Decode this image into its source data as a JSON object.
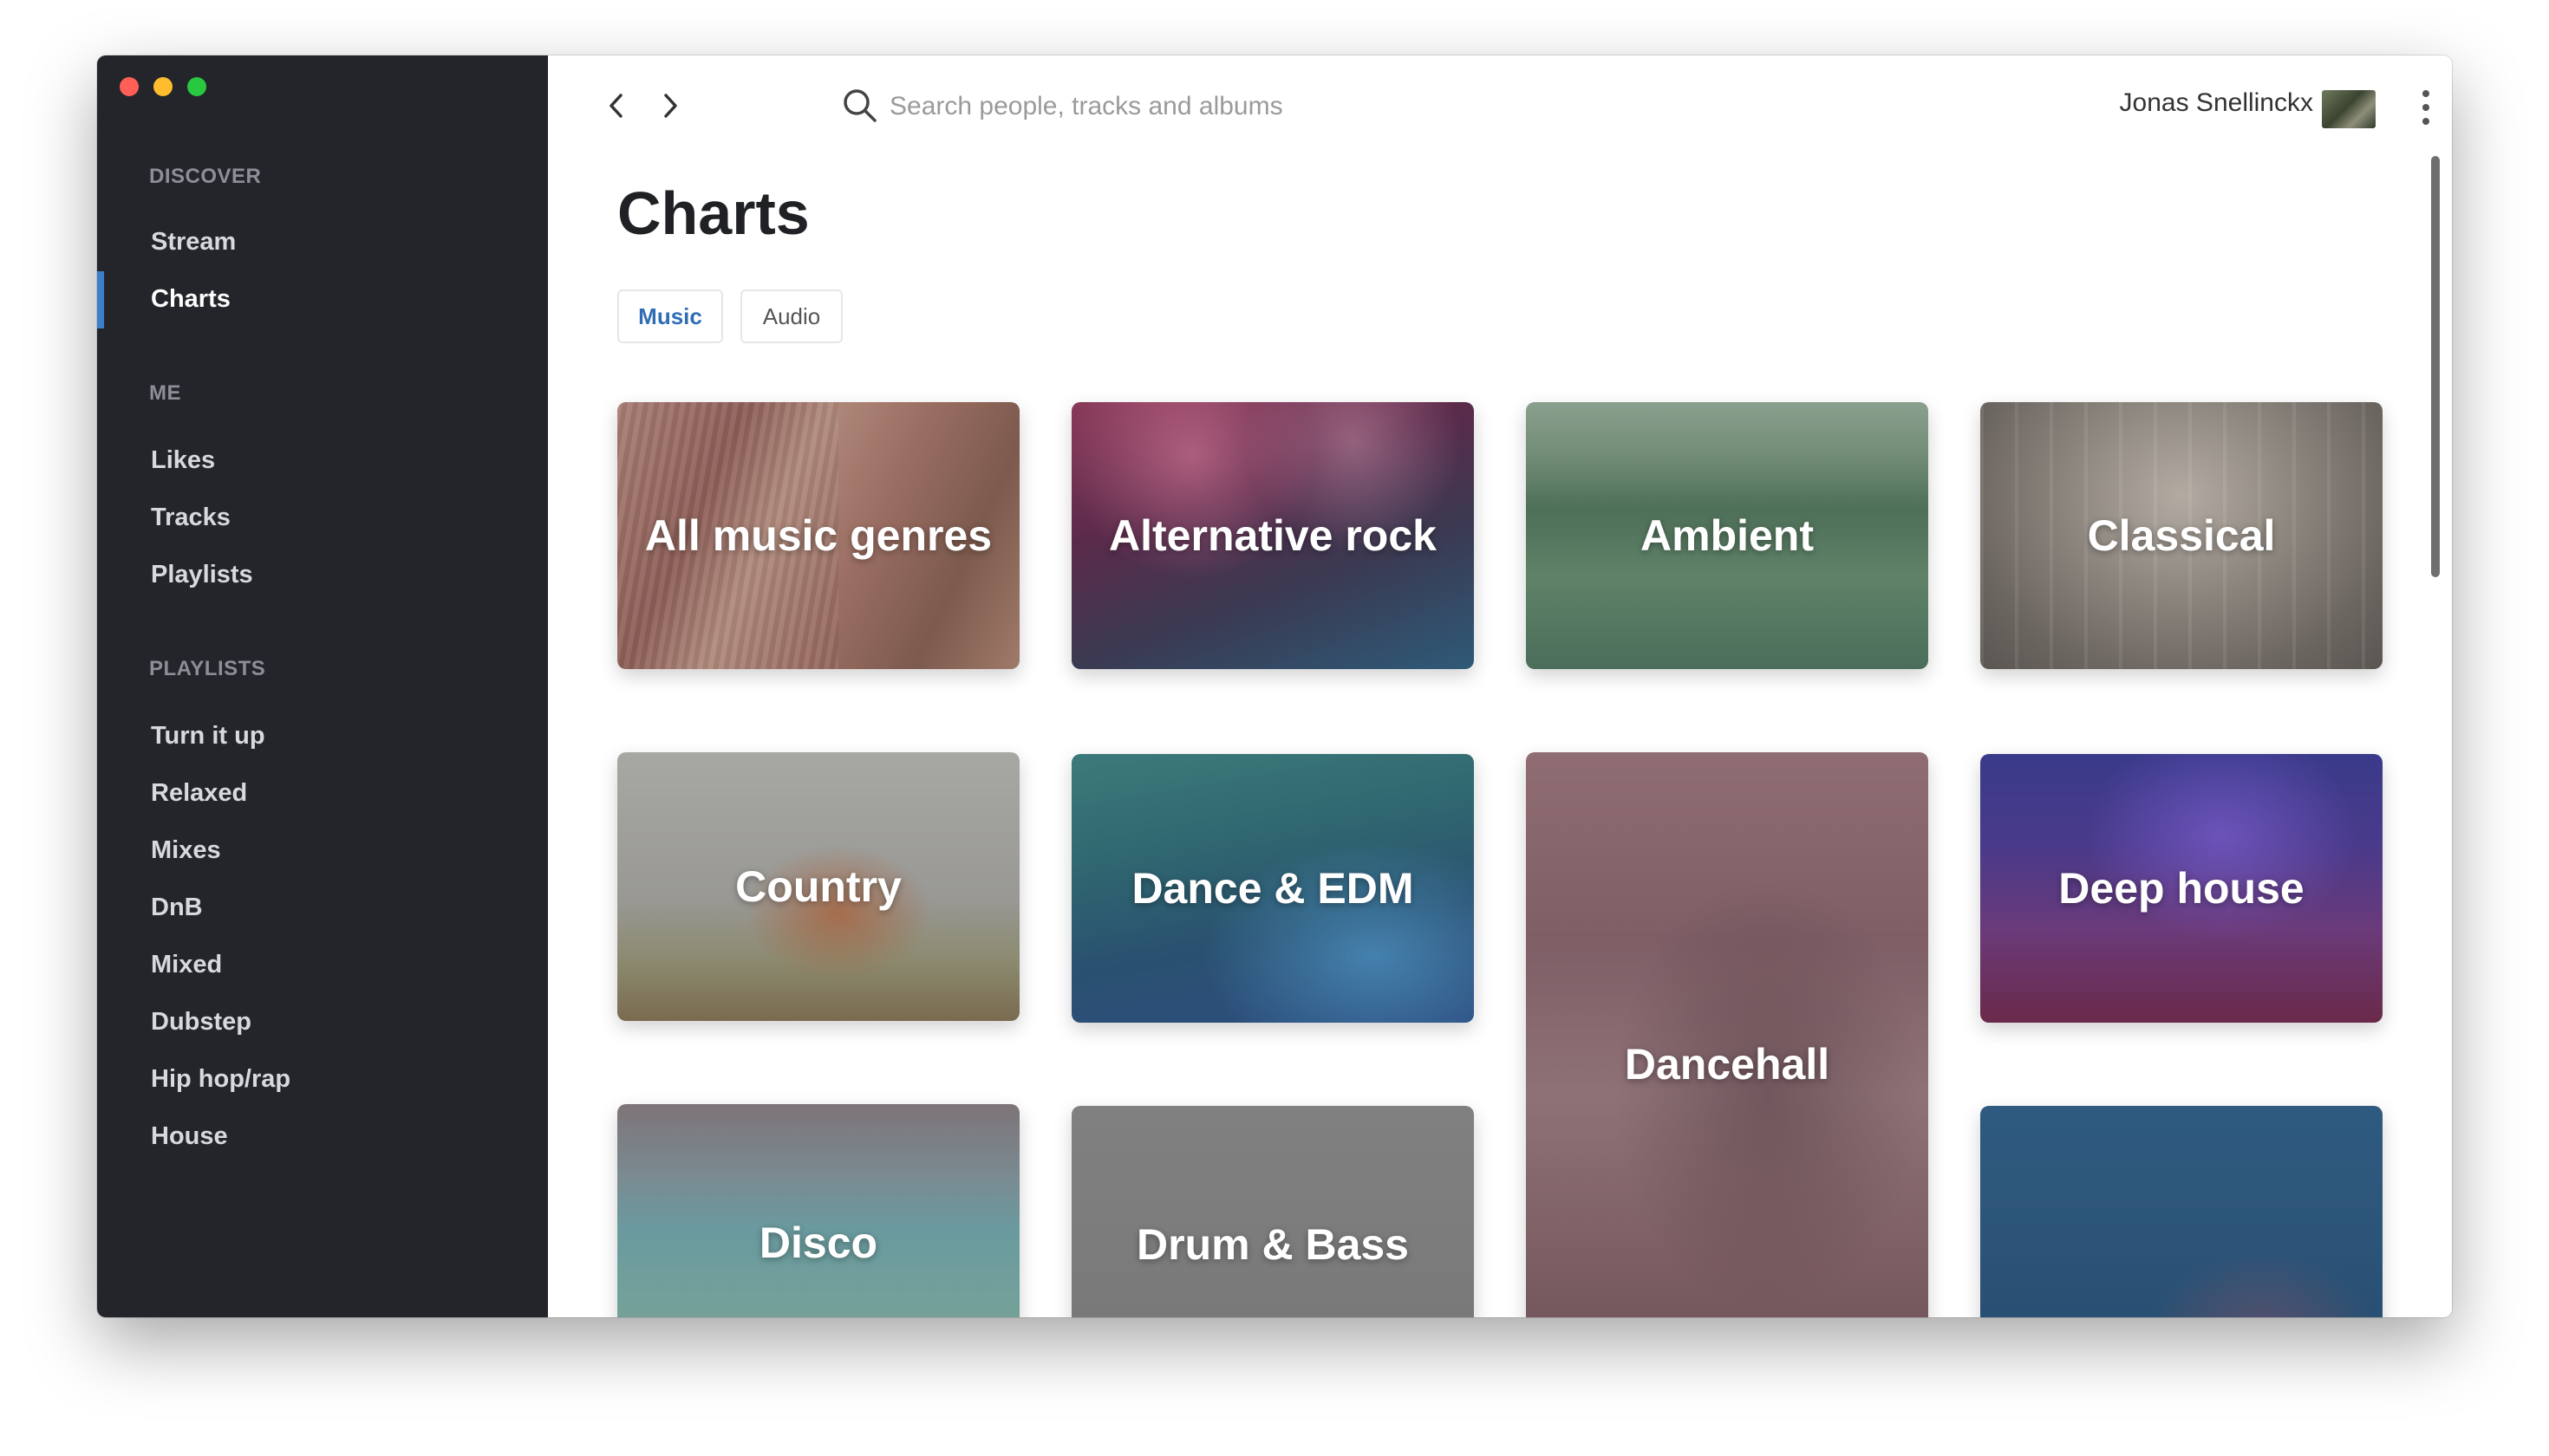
{
  "sidebar": {
    "sections": [
      {
        "title": "DISCOVER",
        "items": [
          {
            "label": "Stream"
          },
          {
            "label": "Charts",
            "active": true
          }
        ]
      },
      {
        "title": "ME",
        "items": [
          {
            "label": "Likes"
          },
          {
            "label": "Tracks"
          },
          {
            "label": "Playlists"
          }
        ]
      },
      {
        "title": "PLAYLISTS",
        "items": [
          {
            "label": "Turn it up"
          },
          {
            "label": "Relaxed"
          },
          {
            "label": "Mixes"
          },
          {
            "label": "DnB"
          },
          {
            "label": "Mixed"
          },
          {
            "label": "Dubstep"
          },
          {
            "label": "Hip hop/rap"
          },
          {
            "label": "House"
          }
        ]
      }
    ]
  },
  "topbar": {
    "search_placeholder": "Search people, tracks and albums",
    "user_name": "Jonas Snellinckx",
    "icons": [
      "chevron-left-icon",
      "chevron-right-icon",
      "search-icon",
      "more-vertical-icon"
    ]
  },
  "page": {
    "title": "Charts",
    "tabs": [
      {
        "label": "Music",
        "selected": true
      },
      {
        "label": "Audio",
        "selected": false
      }
    ]
  },
  "genres": [
    {
      "label": "All music genres"
    },
    {
      "label": "Alternative rock"
    },
    {
      "label": "Ambient"
    },
    {
      "label": "Classical"
    },
    {
      "label": "Country"
    },
    {
      "label": "Dance & EDM"
    },
    {
      "label": "Dancehall"
    },
    {
      "label": "Deep house"
    },
    {
      "label": "Disco"
    },
    {
      "label": "Drum & Bass"
    },
    {
      "label": ""
    }
  ],
  "colors": {
    "sidebar_bg": "#23252a",
    "accent": "#3b7ec9",
    "active_tab_text": "#2f6db5"
  }
}
